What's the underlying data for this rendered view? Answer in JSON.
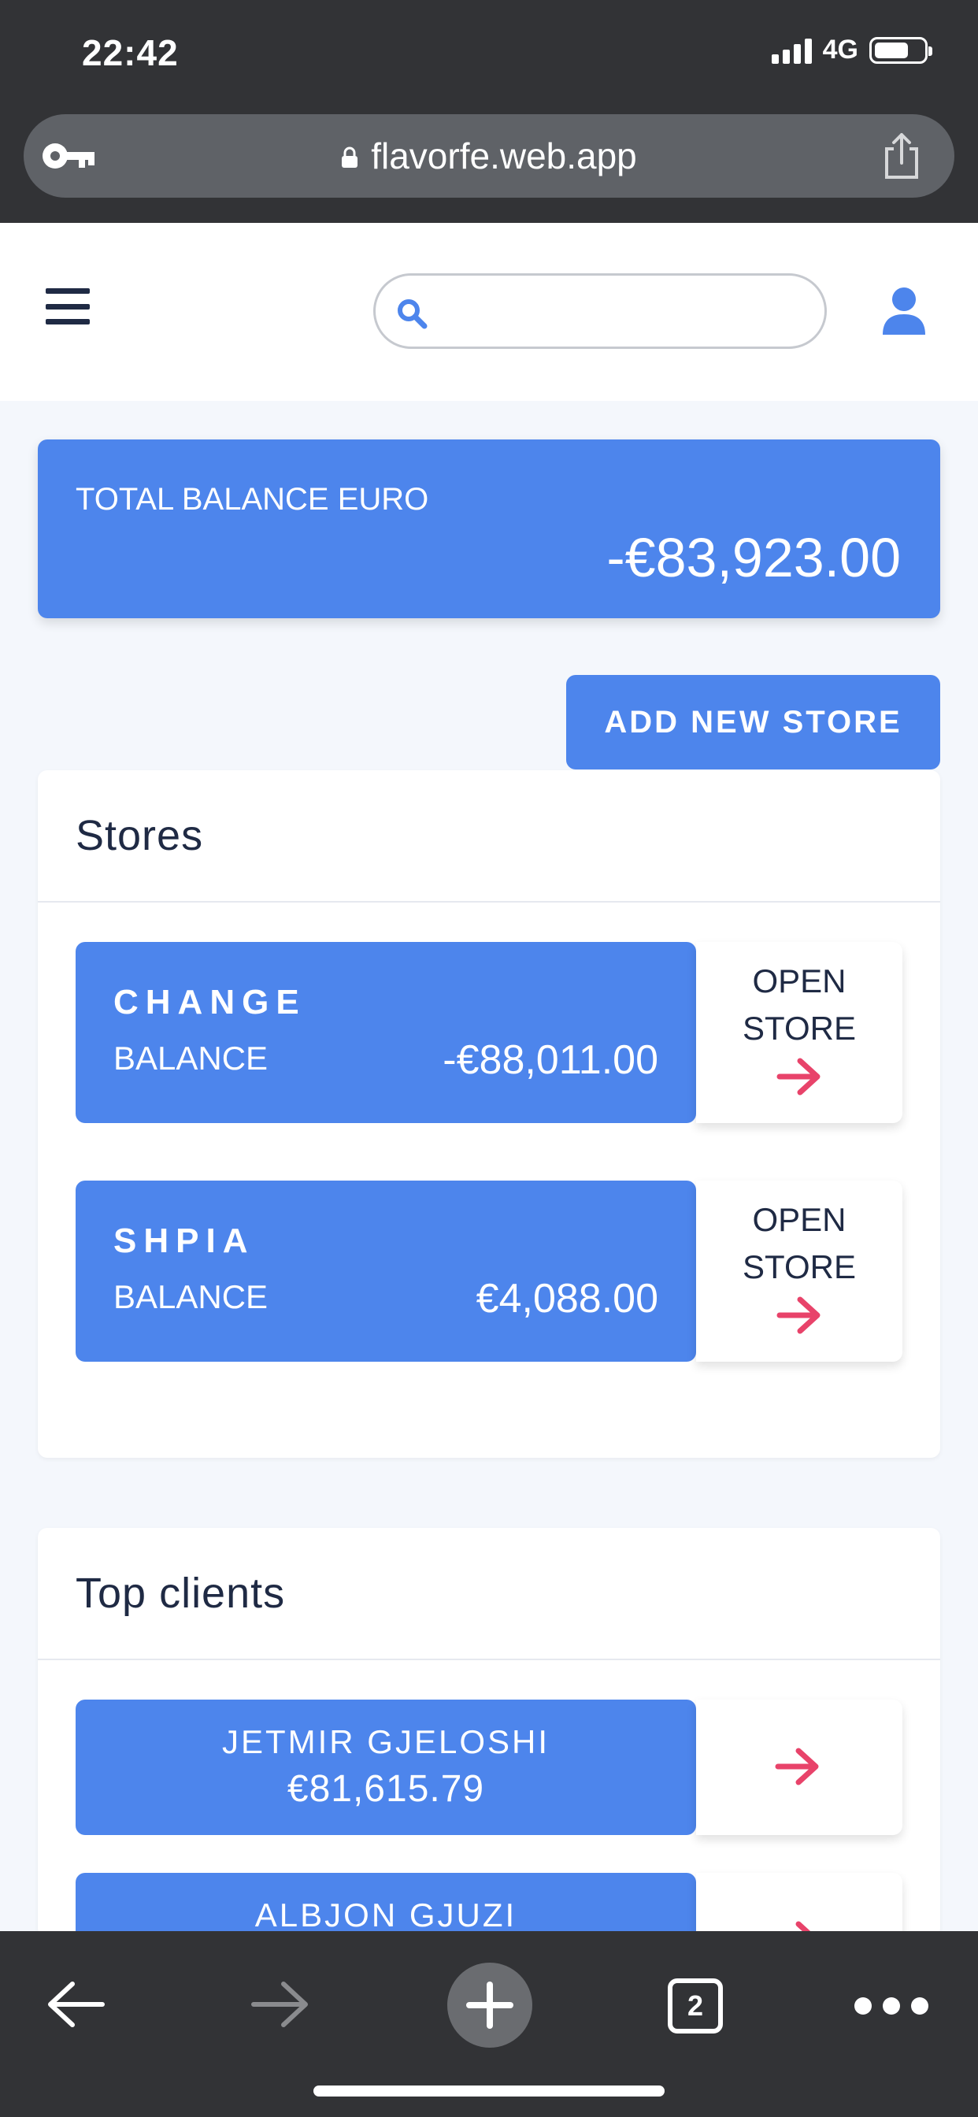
{
  "status_bar": {
    "time": "22:42",
    "network": "4G",
    "battery_level": 0.7
  },
  "browser": {
    "url": "flavorfe.web.app",
    "tab_count": "2"
  },
  "header": {
    "search_placeholder": ""
  },
  "total_balance": {
    "label": "TOTAL BALANCE EURO",
    "value": "-€83,923.00"
  },
  "add_store_label": "ADD NEW STORE",
  "stores": {
    "title": "Stores",
    "items": [
      {
        "name": "CHANGE",
        "balance_label": "BALANCE",
        "balance": "-€88,011.00",
        "open_label": "OPEN\nSTORE"
      },
      {
        "name": "SHPIA",
        "balance_label": "BALANCE",
        "balance": "€4,088.00",
        "open_label": "OPEN\nSTORE"
      }
    ]
  },
  "top_clients": {
    "title": "Top clients",
    "items": [
      {
        "name": "JETMIR GJELOSHI",
        "amount": "€81,615.79"
      },
      {
        "name": "ALBJON GJUZI",
        "amount": ""
      }
    ]
  },
  "colors": {
    "accent": "#4d85ec",
    "arrow": "#e8436a",
    "dark": "#323336",
    "text": "#1f2a44",
    "background": "#f4f7fc"
  },
  "icons": [
    "key-icon",
    "lock-icon",
    "share-icon",
    "menu-icon",
    "search-icon",
    "user-icon",
    "arrow-right-icon",
    "back-icon",
    "forward-icon",
    "new-tab-icon",
    "tabs-icon",
    "more-icon"
  ]
}
